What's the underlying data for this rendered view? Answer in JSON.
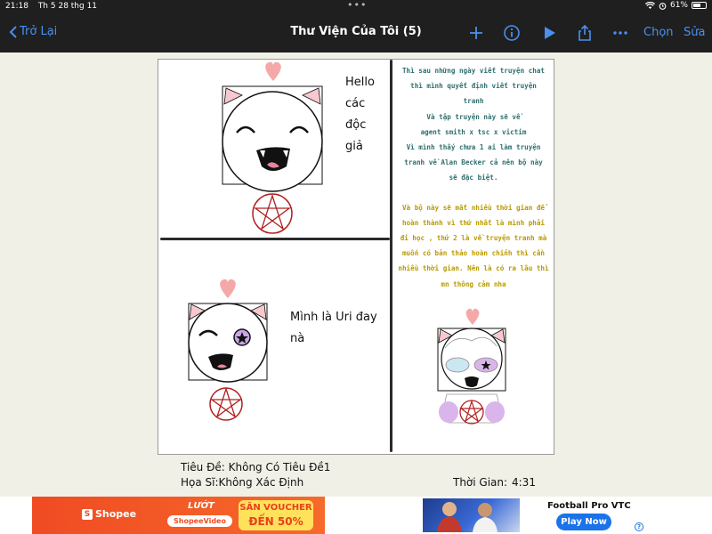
{
  "status_bar": {
    "time": "21:18",
    "date": "Th 5 28 thg 11",
    "battery": "61%",
    "battery_level": 0.61
  },
  "nav": {
    "back_label": "Trở Lại",
    "title": "Thư Viện Của Tôi (5)",
    "select_label": "Chọn",
    "edit_label": "Sửa",
    "accent": "#4a90f0"
  },
  "comic": {
    "panel1_text": "Hello\ncác\nđộc\ngiả",
    "panel3_text": "Mình là Uri đay\nnà",
    "story_p1": "Thì sau những ngày viết truyện chat\nthì mình quyết định viết truyện\ntranh\nVà tập truyện này sẽ về\nagent smith x tsc x victim\nVì mình thấy chưa 1 ai làm truyện\ntranh về Alan Becker cả nên bộ này\nsẽ đặc biệt.",
    "story_p2": "Và bộ này sẽ mất nhiều thời gian để\nhoàn thành vì thứ nhất là mình phải\nđi học , thứ 2 là về truyện tranh mà\nmuốn có bản thảo hoàn chỉnh thì cần\nnhiều thời gian. Nên là có ra lâu thì\nmn thông cảm nha",
    "story_p1_color": "#2f6f6f",
    "story_p2_color": "#b89a00"
  },
  "info": {
    "title": "Tiêu Đề: Không Có Tiêu Đề1",
    "artist": "Họa Sĩ:Không Xác Định",
    "time_label": "Thời Gian:",
    "time_value": "4:31"
  },
  "ads": {
    "shopee_brand": "Shopee",
    "shopee_luot": "LƯỚT",
    "shopee_video": "ShopeeVideo",
    "voucher_line1": "SĂN VOUCHER",
    "voucher_line2": "ĐẾN 50%",
    "vtc_title": "Football Pro VTC",
    "vtc_cta": "Play Now"
  }
}
